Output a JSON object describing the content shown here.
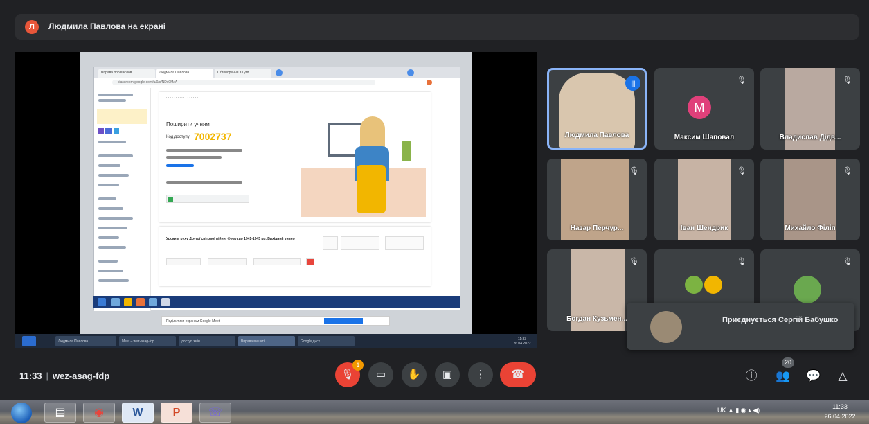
{
  "banner": {
    "avatar_letter": "Л",
    "text": "Людмила Павлова на екрані"
  },
  "shared_screen": {
    "tabs": [
      "Вправа про вислов...",
      "Людмила Павлова",
      "Обговорення в Гугл"
    ],
    "address": "classroom.google.com/u/0/c/NDc0MzA",
    "invite_title": "Поширити учням",
    "code_label": "Код доступу",
    "class_code": "7002737",
    "assignment_title": "Уроки в руху Другої світової війни. Фінал до 1941-1945 рр. Вихідний уявно",
    "notification": "Поділитися екранaм Google Meet",
    "notification_button": "Більше не показувати",
    "taskbar_items": [
      "Людмила Павлова",
      "Meet – wez-asag-fdp",
      "доступ змін...",
      "Вправа вишиті...",
      "Google диск"
    ],
    "clock_time": "11:33",
    "clock_date": "26.04.2022"
  },
  "participants": [
    {
      "name": "Людмила Павлова",
      "speaking": true
    },
    {
      "name": "Максим Шаповал",
      "letter": "M"
    },
    {
      "name": "Владислав Дідв..."
    },
    {
      "name": "Назар Перчур..."
    },
    {
      "name": "Іван Шендрик"
    },
    {
      "name": "Михайло Філіп"
    },
    {
      "name": "Богдан Кузьмен..."
    },
    {
      "name": ""
    },
    {
      "name": ""
    }
  ],
  "toast": {
    "text": "Приєднується Сергій Бабушко"
  },
  "meeting": {
    "time": "11:33",
    "code": "wez-asag-fdp",
    "people_count": "20",
    "raise_hand_badge": "1"
  },
  "icons": {
    "mic": "mic-off-icon",
    "camera": "camera-icon",
    "hand": "raise-hand-icon",
    "present": "present-icon",
    "more": "more-icon",
    "end": "end-call-icon",
    "info": "info-icon",
    "people": "people-icon",
    "chat": "chat-icon",
    "activities": "activities-icon"
  },
  "colors": {
    "meet_bg": "#202124",
    "tile_bg": "#3c4043",
    "end_call": "#ea4335",
    "speaking": "#8ab4f8",
    "code": "#f2b600"
  },
  "taskbar": {
    "apps": [
      "Explorer",
      "Chrome",
      "Word",
      "PowerPoint",
      "Viber"
    ],
    "app_glyphs": [
      "▤",
      "◉",
      "W",
      "P",
      "☏"
    ],
    "tray": "UK",
    "time": "11:33",
    "date": "26.04.2022"
  }
}
